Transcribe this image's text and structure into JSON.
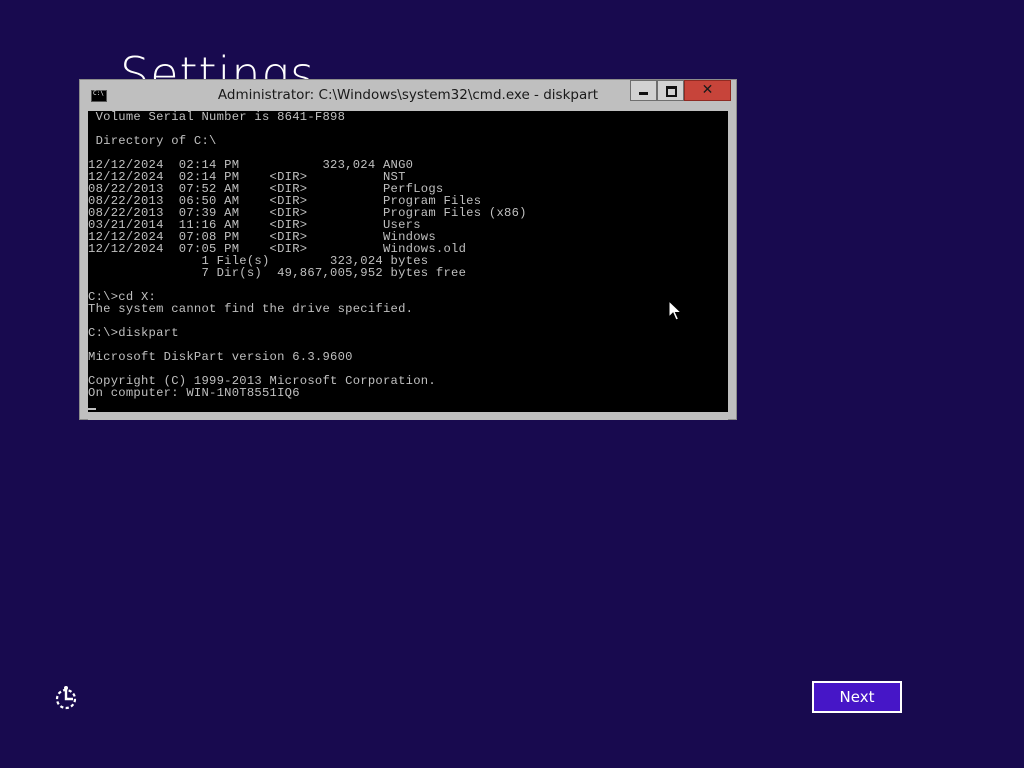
{
  "page": {
    "title": "Settings"
  },
  "cmd_window": {
    "title": "Administrator: C:\\Windows\\system32\\cmd.exe - diskpart",
    "close_glyph": "✕",
    "console_lines": [
      " Volume Serial Number is 8641-F898",
      "",
      " Directory of C:\\",
      "",
      "12/12/2024  02:14 PM           323,024 ANG0",
      "12/12/2024  02:14 PM    <DIR>          NST",
      "08/22/2013  07:52 AM    <DIR>          PerfLogs",
      "08/22/2013  06:50 AM    <DIR>          Program Files",
      "08/22/2013  07:39 AM    <DIR>          Program Files (x86)",
      "03/21/2014  11:16 AM    <DIR>          Users",
      "12/12/2024  07:08 PM    <DIR>          Windows",
      "12/12/2024  07:05 PM    <DIR>          Windows.old",
      "               1 File(s)        323,024 bytes",
      "               7 Dir(s)  49,867,005,952 bytes free",
      "",
      "C:\\>cd X:",
      "The system cannot find the drive specified.",
      "",
      "C:\\>diskpart",
      "",
      "Microsoft DiskPart version 6.3.9600",
      "",
      "Copyright (C) 1999-2013 Microsoft Corporation.",
      "On computer: WIN-1N0T8551IQ6"
    ]
  },
  "footer": {
    "next_label": "Next"
  },
  "colors": {
    "background": "#180a4f",
    "accent": "#4616c7",
    "console_bg": "#000000",
    "console_fg": "#c0c0c0",
    "close_button": "#c7443a"
  },
  "icons": {
    "system_menu": "cmd-icon",
    "accessibility": "ease-of-access-icon",
    "pointer": "mouse-pointer-icon"
  }
}
